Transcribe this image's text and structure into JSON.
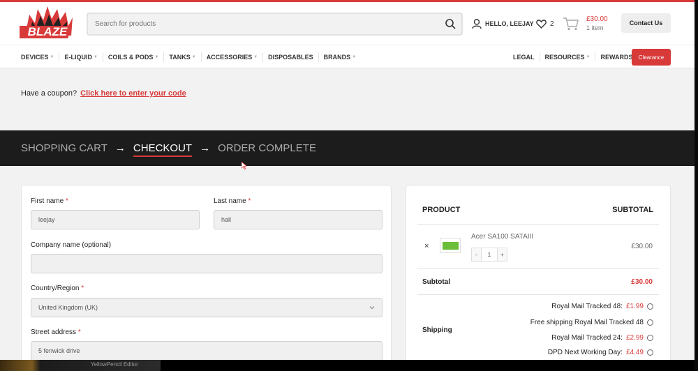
{
  "brand": {
    "logo_text": "BLAZE",
    "accent": "#d83a3a"
  },
  "header": {
    "search_placeholder": "Search for products",
    "account_label": "HELLO, LEEJAY",
    "wishlist_count": "2",
    "cart_price": "£30.00",
    "cart_items": "1 item",
    "contact_label": "Contact Us"
  },
  "nav": {
    "left": [
      {
        "label": "DEVICES",
        "dropdown": true
      },
      {
        "label": "E-LIQUID",
        "dropdown": true
      },
      {
        "label": "COILS & PODS",
        "dropdown": true
      },
      {
        "label": "TANKS",
        "dropdown": true
      },
      {
        "label": "ACCESSORIES",
        "dropdown": true
      },
      {
        "label": "DISPOSABLES",
        "dropdown": false
      },
      {
        "label": "BRANDS",
        "dropdown": true
      }
    ],
    "right": [
      {
        "label": "LEGAL",
        "dropdown": false
      },
      {
        "label": "RESOURCES",
        "dropdown": true
      },
      {
        "label": "REWARDS",
        "dropdown": false
      }
    ],
    "clearance_label": "Clearance"
  },
  "coupon": {
    "text": "Have a coupon?",
    "link": "Click here to enter your code"
  },
  "steps": {
    "cart": "SHOPPING CART",
    "checkout": "CHECKOUT",
    "complete": "ORDER COMPLETE",
    "arrow": "→"
  },
  "billing": {
    "first_name_label": "First name",
    "first_name_value": "leejay",
    "last_name_label": "Last name",
    "last_name_value": "hall",
    "company_label": "Company name (optional)",
    "company_value": "",
    "country_label": "Country/Region",
    "country_value": "United Kingdom (UK)",
    "street_label": "Street address",
    "street_value": "5 fenwick drive",
    "required_mark": "*"
  },
  "order": {
    "product_header": "PRODUCT",
    "subtotal_header": "SUBTOTAL",
    "remove_symbol": "×",
    "item_name": "Acer SA100 SATAIII",
    "qty_minus": "-",
    "qty_value": "1",
    "qty_plus": "+",
    "item_price": "£30.00",
    "subtotal_label": "Subtotal",
    "subtotal_value": "£30.00",
    "shipping_label": "Shipping",
    "shipping_options": [
      {
        "name": "Royal Mail Tracked 48:",
        "price": "£1.99"
      },
      {
        "name": "Free shipping Royal Mail Tracked 48",
        "price": ""
      },
      {
        "name": "Royal Mail Tracked 24:",
        "price": "£2.99"
      },
      {
        "name": "DPD Next Working Day:",
        "price": "£4.49"
      }
    ]
  },
  "taskbar": {
    "text": "YellowPencil Editor"
  }
}
